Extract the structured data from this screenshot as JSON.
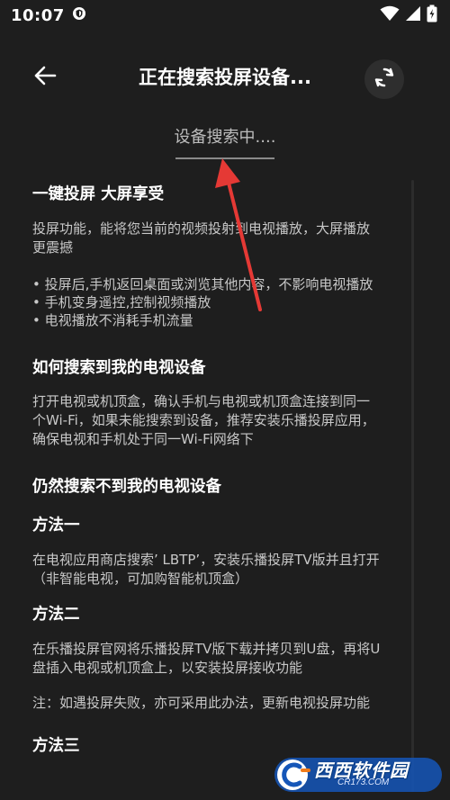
{
  "status_bar": {
    "time": "10:07"
  },
  "header": {
    "title": "正在搜索投屏设备..."
  },
  "search": {
    "status_text": "设备搜索中...."
  },
  "content": {
    "section1": {
      "heading": "一键投屏 大屏享受",
      "intro_line1": "投屏功能，能将您当前的视频投射到电视播放，大屏播放",
      "intro_line2": "更震撼",
      "bullets": [
        "• 投屏后,手机返回桌面或浏览其他内容，不影响电视播放",
        "• 手机变身遥控,控制视频播放",
        "• 电视播放不消耗手机流量"
      ]
    },
    "section2": {
      "heading": "如何搜索到我的电视设备",
      "lines": [
        "打开电视或机顶盒，确认手机与电视或机顶盒连接到同一",
        "个Wi-Fi，如果未能搜索到设备，推荐安装乐播投屏应用，",
        "确保电视和手机处于同一Wi-Fi网络下"
      ]
    },
    "section3": {
      "heading": "仍然搜索不到我的电视设备",
      "method1": {
        "title": "方法一",
        "lines": [
          "在电视应用商店搜索’ LBTP’，安装乐播投屏TV版并且打开",
          "（非智能电视，可加购智能机顶盒）"
        ]
      },
      "method2": {
        "title": "方法二",
        "lines": [
          "在乐播投屏官网将乐播投屏TV版下载并拷贝到U盘，再将U",
          "盘插入电视或机顶盒上，以安装投屏接收功能"
        ],
        "note": "注：如遇投屏失败，亦可采用此办法，更新电视投屏功能"
      },
      "method3": {
        "title": "方法三"
      }
    }
  },
  "watermark": {
    "brand": "西西软件园",
    "domain": "CR173.COM"
  },
  "colors": {
    "background": "#1e1e1e",
    "body_text": "#c8c8c8",
    "arrow": "#e53935"
  },
  "icons": {
    "status": [
      "shield-icon",
      "wifi-icon",
      "signal-icon",
      "battery-icon"
    ],
    "header": [
      "back-arrow-icon",
      "refresh-icon"
    ]
  }
}
